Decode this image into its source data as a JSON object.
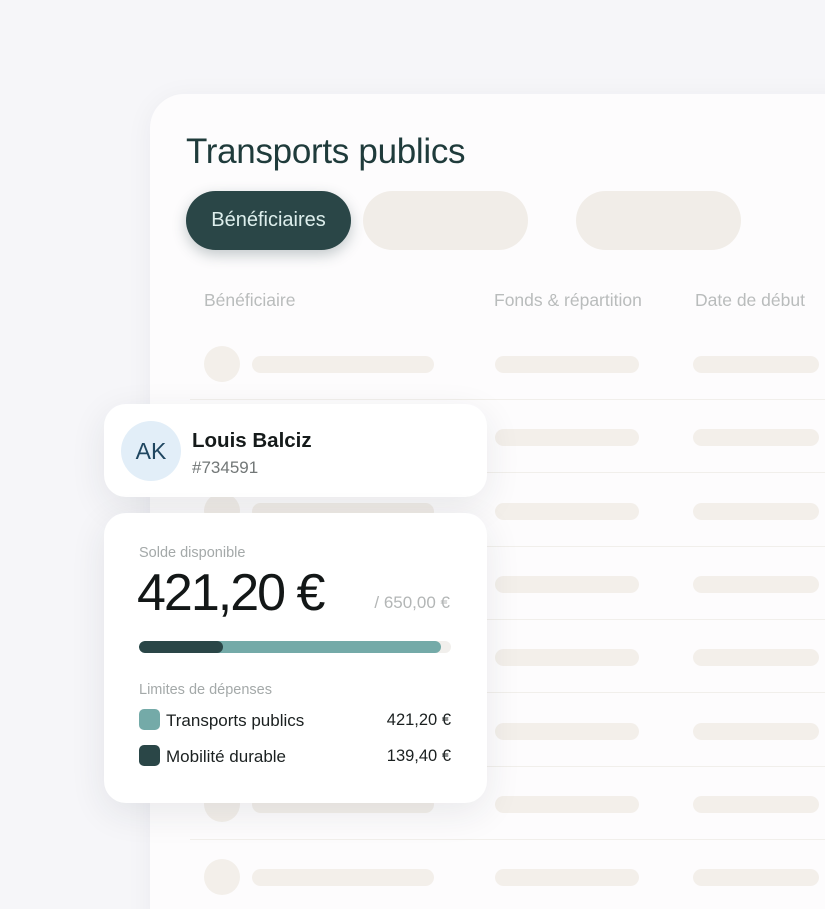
{
  "page": {
    "title": "Transports publics",
    "tabs": [
      {
        "label": "Bénéficiaires",
        "active": true
      },
      {
        "label": "",
        "active": false
      },
      {
        "label": "",
        "active": false
      }
    ]
  },
  "table": {
    "headers": [
      "Bénéficiaire",
      "Fonds & répartition",
      "Date de début"
    ],
    "skeleton_rows": 8
  },
  "user": {
    "initials": "AK",
    "name": "Louis Balciz",
    "id": "#734591"
  },
  "balance": {
    "label": "Solde disponible",
    "amount": "421,20 €",
    "total": "/ 650,00 €",
    "progress": {
      "available_fraction": 0.9677,
      "spent_fraction": 0.2694
    },
    "limits_label": "Limites de dépenses",
    "limits": [
      {
        "name": "Transports publics",
        "amount": "421,20 €",
        "color": "#74aaa8"
      },
      {
        "name": "Mobilité durable",
        "amount": "139,40 €",
        "color": "#2a4647"
      }
    ]
  },
  "colors": {
    "accent_dark": "#2a4647",
    "accent_light": "#74aaa8",
    "skeleton": "#f3efea",
    "avatar_bg": "#e2eef8"
  }
}
